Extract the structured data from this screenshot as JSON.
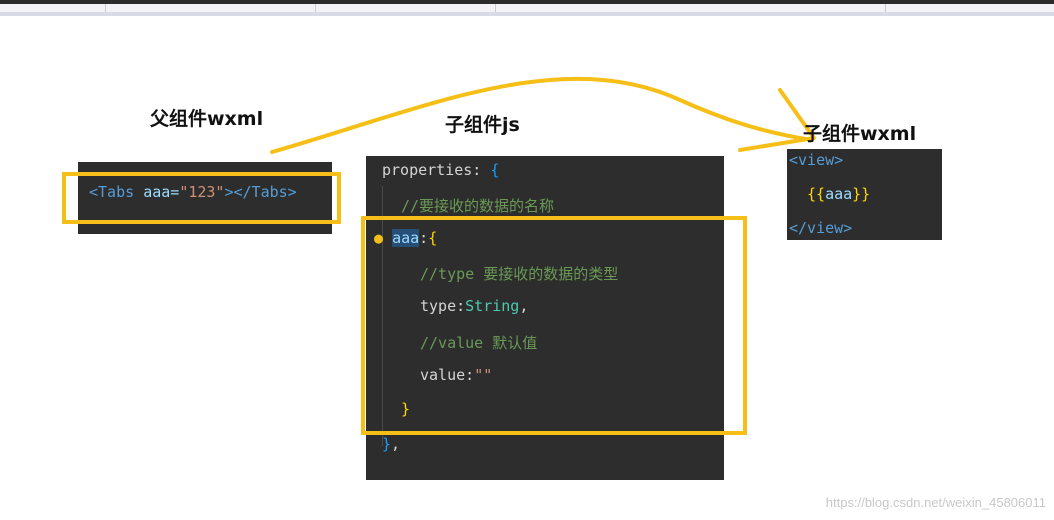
{
  "labels": {
    "parent_wxml": "父组件wxml",
    "child_js": "子组件js",
    "child_wxml": "子组件wxml"
  },
  "parent_code": {
    "open_tag": "<Tabs",
    "attr": "aaa=",
    "value": "\"123\"",
    "close": "></Tabs>"
  },
  "child_js_code": {
    "line1_key": "properties: ",
    "line1_brace": "{",
    "line2": "//要接收的数据的名称",
    "line3_key": "aaa",
    "line3_colon": ":",
    "line3_brace": "{",
    "line4": "//type 要接收的数据的类型",
    "line5_key": "type:",
    "line5_val": "String",
    "line5_end": ",",
    "line6": "//value 默认值",
    "line7_key": "value:",
    "line7_val": "\"\"",
    "line8_brace": "}",
    "line9_brace": "}",
    "line9_end": ","
  },
  "child_wxml_code": {
    "open": "<view>",
    "inner_open": "{{",
    "inner_var": "aaa",
    "inner_close": "}}",
    "close": "</view>"
  },
  "watermark": "https://blog.csdn.net/weixin_45806011",
  "colors": {
    "highlight": "#f5bf17",
    "arrow": "#f5bf17",
    "code_bg": "#2d2d2d"
  }
}
